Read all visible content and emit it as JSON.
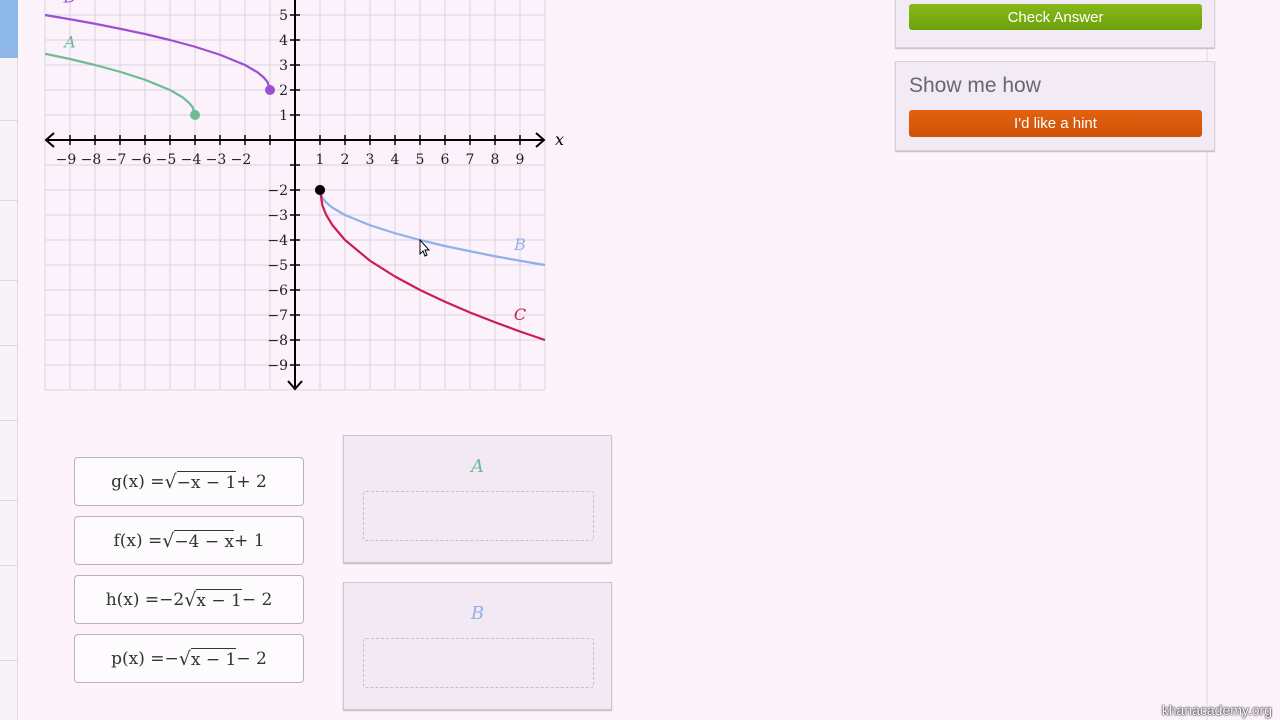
{
  "chart_data": {
    "type": "line",
    "xlabel": "x",
    "xlim": [
      -10,
      10
    ],
    "ylim": [
      -10,
      10
    ],
    "grid": true,
    "x_ticks": [
      -9,
      -8,
      -7,
      -6,
      -5,
      -4,
      -3,
      -2,
      1,
      2,
      3,
      4,
      5,
      6,
      7,
      8,
      9
    ],
    "y_ticks": [
      5,
      4,
      3,
      2,
      1,
      -2,
      -3,
      -4,
      -5,
      -6,
      -7,
      -8,
      -9
    ],
    "series": [
      {
        "name": "D",
        "color": "#9d4fd3",
        "endpoint": [
          -1,
          2
        ],
        "endpoint_color": "#9d4fd3",
        "label_at": [
          -9,
          5.5
        ],
        "points": [
          [
            -10,
            5
          ],
          [
            -9,
            4.83
          ],
          [
            -8,
            4.65
          ],
          [
            -7,
            4.45
          ],
          [
            -6,
            4.24
          ],
          [
            -5,
            4
          ],
          [
            -4,
            3.73
          ],
          [
            -3,
            3.41
          ],
          [
            -2,
            3
          ],
          [
            -1.5,
            2.71
          ],
          [
            -1.25,
            2.5
          ],
          [
            -1.1,
            2.32
          ],
          [
            -1,
            2
          ]
        ]
      },
      {
        "name": "A",
        "color": "#6fbb93",
        "endpoint": [
          -4,
          1
        ],
        "endpoint_color": "#6fbb93",
        "label_at": [
          -9,
          3.7
        ],
        "points": [
          [
            -10,
            3.45
          ],
          [
            -9,
            3.24
          ],
          [
            -8,
            3
          ],
          [
            -7,
            2.73
          ],
          [
            -6,
            2.41
          ],
          [
            -5,
            2
          ],
          [
            -4.5,
            1.71
          ],
          [
            -4.25,
            1.5
          ],
          [
            -4.1,
            1.32
          ],
          [
            -4,
            1
          ]
        ]
      },
      {
        "name": "B",
        "color": "#8fb0ea",
        "endpoint": [
          1,
          -2
        ],
        "endpoint_color": "#000000",
        "label_at": [
          9,
          -4.4
        ],
        "points": [
          [
            1,
            -2
          ],
          [
            1.1,
            -2.32
          ],
          [
            1.25,
            -2.5
          ],
          [
            1.5,
            -2.71
          ],
          [
            2,
            -3
          ],
          [
            3,
            -3.41
          ],
          [
            4,
            -3.73
          ],
          [
            5,
            -4
          ],
          [
            6,
            -4.24
          ],
          [
            7,
            -4.45
          ],
          [
            8,
            -4.65
          ],
          [
            9,
            -4.83
          ],
          [
            10,
            -5
          ]
        ]
      },
      {
        "name": "C",
        "color": "#cc1d52",
        "endpoint": [
          1,
          -2
        ],
        "endpoint_color": "#000000",
        "label_at": [
          9,
          -7.2
        ],
        "points": [
          [
            1,
            -2
          ],
          [
            1.1,
            -2.63
          ],
          [
            1.25,
            -3
          ],
          [
            1.5,
            -3.41
          ],
          [
            2,
            -4
          ],
          [
            3,
            -4.83
          ],
          [
            4,
            -5.46
          ],
          [
            5,
            -6
          ],
          [
            6,
            -6.47
          ],
          [
            7,
            -6.9
          ],
          [
            8,
            -7.29
          ],
          [
            9,
            -7.66
          ],
          [
            10,
            -8
          ]
        ]
      }
    ]
  },
  "cards": [
    {
      "lhs": "g(x) = ",
      "pre": "",
      "radicand": "−x − 1",
      "post": " + 2"
    },
    {
      "lhs": "f(x) = ",
      "pre": "",
      "radicand": "−4 − x",
      "post": " + 1"
    },
    {
      "lhs": "h(x) = ",
      "pre": "−2",
      "radicand": "x − 1",
      "post": " − 2"
    },
    {
      "lhs": "p(x) = ",
      "pre": "−",
      "radicand": "x − 1",
      "post": " − 2"
    }
  ],
  "drops": [
    {
      "label": "A",
      "color": "#6fbb93"
    },
    {
      "label": "B",
      "color": "#8fb0ea"
    }
  ],
  "sidebar": {
    "check_answer": "Check Answer",
    "show_me_how": "Show me how",
    "hint": "I'd like a hint"
  },
  "watermark": "khanacademy.org"
}
